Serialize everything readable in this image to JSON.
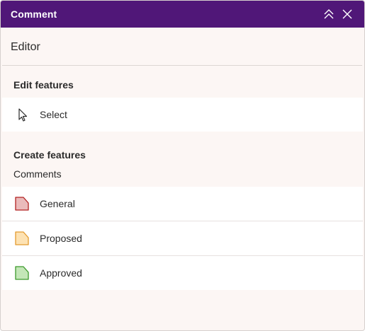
{
  "header": {
    "title": "Comment",
    "collapse_icon": "chevrons-up-icon",
    "close_icon": "close-icon",
    "background": "#501778"
  },
  "editor": {
    "title": "Editor"
  },
  "edit_features": {
    "title": "Edit features",
    "items": [
      {
        "label": "Select",
        "icon": "cursor-arrow-icon"
      }
    ]
  },
  "create_features": {
    "title": "Create features",
    "layer": "Comments",
    "items": [
      {
        "label": "General",
        "icon": "polygon-swatch-icon",
        "fill": "#eababa",
        "stroke": "#b22222"
      },
      {
        "label": "Proposed",
        "icon": "polygon-swatch-icon",
        "fill": "#fde2b3",
        "stroke": "#e39a2e"
      },
      {
        "label": "Approved",
        "icon": "polygon-swatch-icon",
        "fill": "#c3e6b7",
        "stroke": "#3c9a2c"
      }
    ]
  }
}
